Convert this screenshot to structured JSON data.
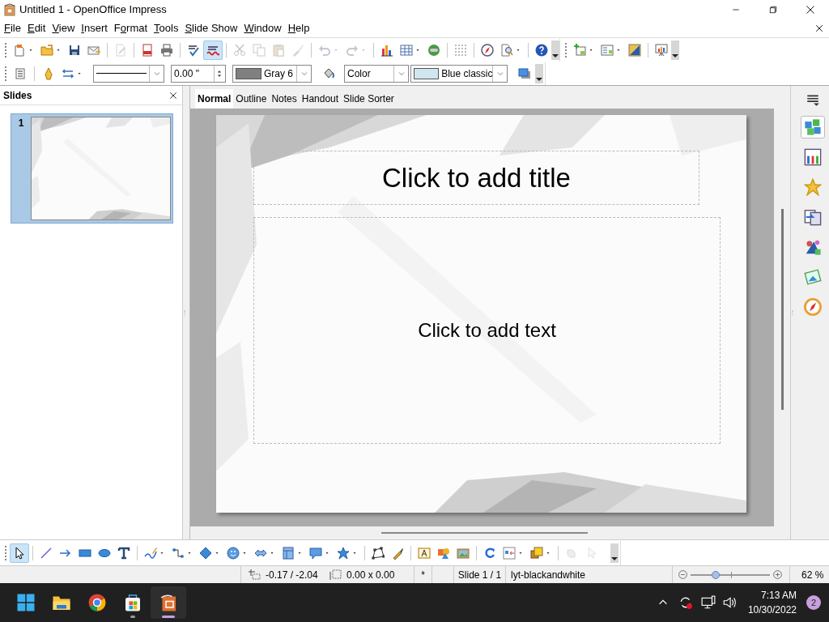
{
  "window": {
    "title": "Untitled 1 - OpenOffice Impress"
  },
  "menu": [
    {
      "key": "F",
      "after": "ile"
    },
    {
      "key": "E",
      "after": "dit"
    },
    {
      "key": "V",
      "after": "iew"
    },
    {
      "key": "I",
      "after": "nsert"
    },
    {
      "before": "F",
      "key": "o",
      "after": "rmat"
    },
    {
      "key": "T",
      "after": "ools"
    },
    {
      "key": "S",
      "after": "lide Show"
    },
    {
      "key": "W",
      "after": "indow"
    },
    {
      "key": "H",
      "after": "elp"
    }
  ],
  "standard_toolbar": [
    {
      "disabled": false,
      "on": false
    },
    {
      "disabled": false,
      "on": false
    },
    {
      "disabled": false,
      "on": false
    },
    {
      "disabled": false,
      "on": false
    },
    {
      "disabled": true,
      "on": false
    },
    {
      "disabled": false,
      "on": false
    },
    {
      "disabled": false,
      "on": false
    },
    {
      "disabled": false,
      "on": false
    },
    {
      "disabled": false,
      "on": true
    },
    {
      "disabled": true,
      "on": false
    },
    {
      "disabled": true,
      "on": false
    },
    {
      "disabled": true,
      "on": false
    },
    {
      "disabled": true,
      "on": false
    },
    {
      "disabled": true,
      "on": false
    },
    {
      "disabled": true,
      "on": false
    },
    {
      "disabled": false,
      "on": false
    },
    {
      "disabled": false,
      "on": false
    },
    {
      "disabled": false,
      "on": false
    },
    {
      "disabled": false,
      "on": false
    },
    {
      "disabled": false,
      "on": false
    },
    {
      "disabled": false,
      "on": false
    },
    {
      "disabled": false,
      "on": false
    }
  ],
  "line_toolbar": {
    "line_width": "0.00 \"",
    "line_color": {
      "label": "Gray 6",
      "color": "#808080"
    },
    "area_style": "Color",
    "area_fill": {
      "label": "Blue classic",
      "color": "#d0e6f0"
    }
  },
  "slides_pane": {
    "title": "Slides",
    "slides": [
      {
        "number": "1",
        "selected": true
      }
    ]
  },
  "view_tabs": [
    {
      "label": "Normal",
      "selected": true
    },
    {
      "label": "Outline",
      "selected": false
    },
    {
      "label": "Notes",
      "selected": false
    },
    {
      "label": "Handout",
      "selected": false
    },
    {
      "label": "Slide Sorter",
      "selected": false
    }
  ],
  "slide": {
    "title_placeholder": "Click to add title",
    "text_placeholder": "Click to add text"
  },
  "sidebar": {
    "decks": [
      {
        "selected": true
      },
      {
        "selected": false
      },
      {
        "selected": false
      },
      {
        "selected": false
      },
      {
        "selected": false
      },
      {
        "selected": false
      },
      {
        "selected": false
      }
    ]
  },
  "drawing_toolbar": [
    {
      "disabled": false,
      "on": true
    },
    {
      "disabled": false,
      "on": false
    },
    {
      "disabled": false,
      "on": false
    },
    {
      "disabled": false,
      "on": false
    },
    {
      "disabled": false,
      "on": false
    },
    {
      "disabled": false,
      "on": false
    },
    {
      "disabled": false,
      "on": false
    },
    {
      "disabled": false,
      "on": false
    },
    {
      "disabled": false,
      "on": false
    },
    {
      "disabled": false,
      "on": false
    },
    {
      "disabled": false,
      "on": false
    },
    {
      "disabled": false,
      "on": false
    },
    {
      "disabled": false,
      "on": false
    },
    {
      "disabled": false,
      "on": false
    },
    {
      "disabled": false,
      "on": false
    },
    {
      "disabled": false,
      "on": false
    },
    {
      "disabled": false,
      "on": false
    },
    {
      "disabled": false,
      "on": false
    },
    {
      "disabled": false,
      "on": false
    },
    {
      "disabled": false,
      "on": false
    },
    {
      "disabled": false,
      "on": false
    },
    {
      "disabled": false,
      "on": false
    },
    {
      "disabled": true,
      "on": false
    },
    {
      "disabled": true,
      "on": false
    }
  ],
  "status_bar": {
    "position": "-0.17 / -2.04",
    "size": "0.00 x 0.00",
    "modified": "*",
    "slide": "Slide 1 / 1",
    "layout": "lyt-blackandwhite",
    "zoom": {
      "level": 0.32,
      "value": "62 %"
    }
  },
  "taskbar": {
    "apps": [
      {
        "selected": false,
        "running": false
      },
      {
        "selected": false,
        "running": false
      },
      {
        "selected": false,
        "running": true
      },
      {
        "selected": true,
        "running": true
      }
    ],
    "time": "7:13 AM",
    "date": "10/30/2022",
    "notifications": "2"
  }
}
